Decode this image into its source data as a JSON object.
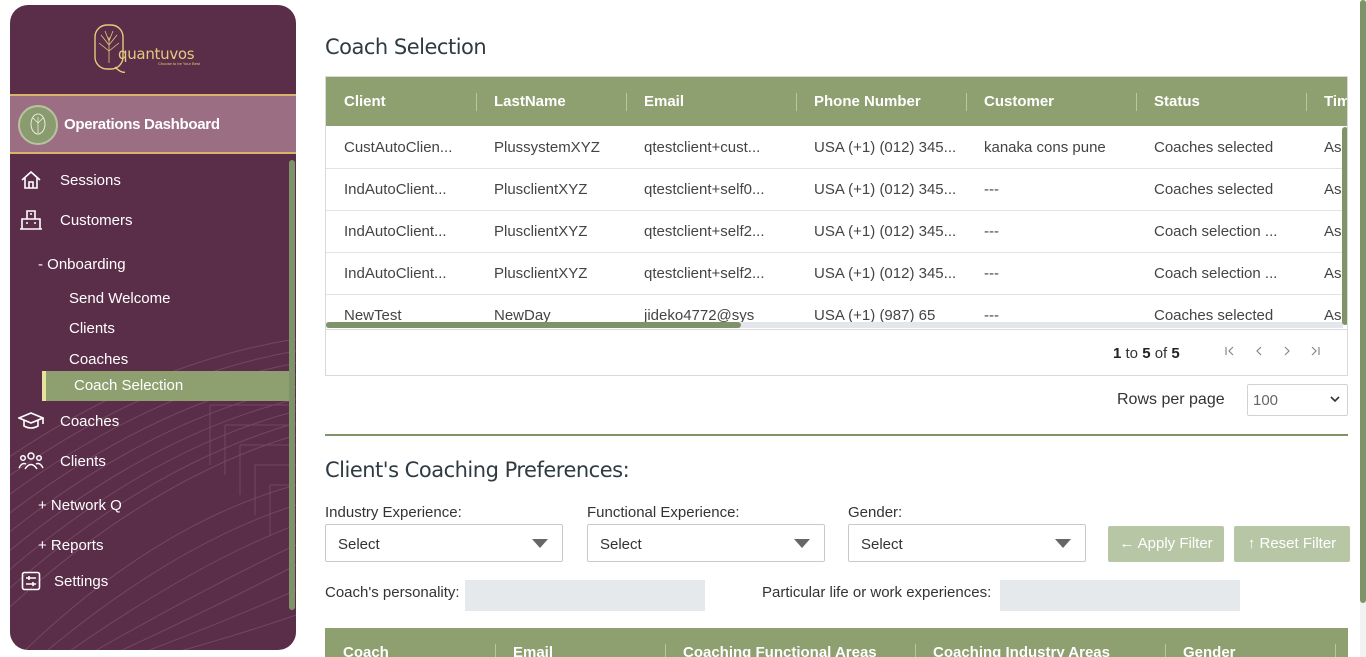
{
  "brand": {
    "name": "quantuvos",
    "tagline": "Choose to be Your Best",
    "accent": "#8ea06f",
    "sidebar_bg": "#5a2d48"
  },
  "sidebar": {
    "ops_title": "Operations Dashboard",
    "items": [
      {
        "label": "Sessions",
        "icon": "home-icon"
      },
      {
        "label": "Customers",
        "icon": "building-icon"
      },
      {
        "label": "- Onboarding"
      },
      {
        "label": "Send Welcome"
      },
      {
        "label": "Clients"
      },
      {
        "label": "Coaches"
      },
      {
        "label": "Coach Selection",
        "active": true
      },
      {
        "label": "Coaches",
        "icon": "graduation-cap-icon"
      },
      {
        "label": "Clients",
        "icon": "users-icon"
      },
      {
        "label": "+ Network Q"
      },
      {
        "label": "+ Reports"
      },
      {
        "label": "Settings",
        "icon": "settings-icon"
      }
    ]
  },
  "main": {
    "title": "Coach Selection",
    "grid": {
      "columns": [
        "Client",
        "LastName",
        "Email",
        "Phone Number",
        "Customer",
        "Status",
        "Tim"
      ],
      "rows": [
        [
          "CustAutoClien...",
          "PlussystemXYZ",
          "qtestclient+cust...",
          "USA (+1) (012) 345...",
          "kanaka cons pune",
          "Coaches selected",
          "As"
        ],
        [
          "IndAutoClient...",
          "PlusclientXYZ",
          "qtestclient+self0...",
          "USA (+1) (012) 345...",
          "---",
          "Coaches selected",
          "As"
        ],
        [
          "IndAutoClient...",
          "PlusclientXYZ",
          "qtestclient+self2...",
          "USA (+1) (012) 345...",
          "---",
          "Coach selection ...",
          "As"
        ],
        [
          "IndAutoClient...",
          "PlusclientXYZ",
          "qtestclient+self2...",
          "USA (+1) (012) 345...",
          "---",
          "Coach selection ...",
          "As"
        ],
        [
          "NewTest",
          "NewDay",
          "jideko4772@sys",
          "USA (+1) (987) 65",
          "---",
          "Coaches selected",
          "As"
        ]
      ],
      "pager": {
        "from": "1",
        "to_word": "to",
        "to": "5",
        "of_word": "of",
        "total": "5"
      },
      "rows_per_page_label": "Rows per page",
      "rows_per_page_value": "100"
    },
    "preferences": {
      "title": "Client's Coaching Preferences:",
      "industry_label": "Industry Experience:",
      "industry_value": "Select",
      "functional_label": "Functional Experience:",
      "functional_value": "Select",
      "gender_label": "Gender:",
      "gender_value": "Select",
      "apply_label": "← Apply Filter",
      "reset_label": "↑ Reset Filter",
      "personality_label": "Coach's personality:",
      "experiences_label": "Particular life or work experiences:"
    },
    "coach_grid": {
      "columns": [
        "Coach",
        "Email",
        "Coaching Functional Areas",
        "Coaching Industry Areas",
        "Gender"
      ]
    }
  }
}
